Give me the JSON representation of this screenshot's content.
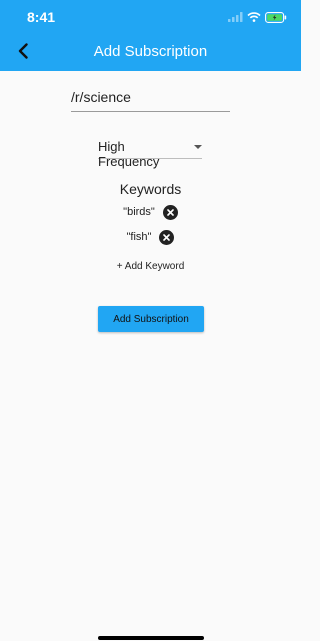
{
  "status_bar": {
    "time": "8:41"
  },
  "header": {
    "title": "Add Subscription",
    "accent_color": "#21a6f3"
  },
  "subreddit": {
    "value": "/r/science"
  },
  "frequency": {
    "selected": "High Frequency"
  },
  "keywords": {
    "heading": "Keywords",
    "items": [
      {
        "label": "\"birds\""
      },
      {
        "label": "\"fish\""
      }
    ],
    "add_label": "+ Add Keyword"
  },
  "actions": {
    "submit_label": "Add Subscription"
  }
}
